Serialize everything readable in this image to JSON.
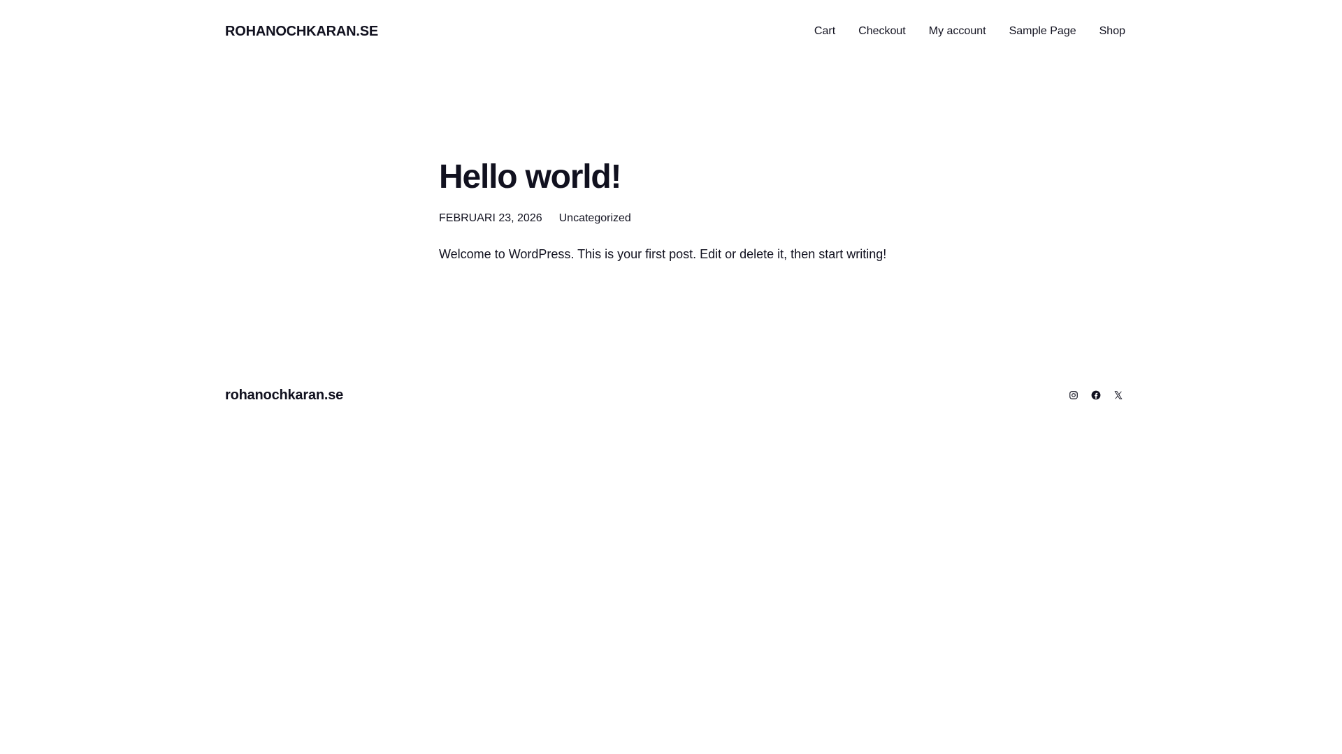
{
  "header": {
    "site_title": "ROHANOCHKARAN.SE",
    "nav": [
      {
        "label": "Cart"
      },
      {
        "label": "Checkout"
      },
      {
        "label": "My account"
      },
      {
        "label": "Sample Page"
      },
      {
        "label": "Shop"
      }
    ]
  },
  "post": {
    "title": "Hello world!",
    "date": "FEBRUARI 23, 2026",
    "category": "Uncategorized",
    "content": "Welcome to WordPress. This is your first post. Edit or delete it, then start writing!"
  },
  "footer": {
    "site_title": "rohanochkaran.se",
    "social": [
      {
        "icon": "instagram-icon"
      },
      {
        "icon": "facebook-icon"
      },
      {
        "icon": "x-icon"
      }
    ]
  },
  "colors": {
    "text": "#11111f",
    "background": "#ffffff"
  }
}
